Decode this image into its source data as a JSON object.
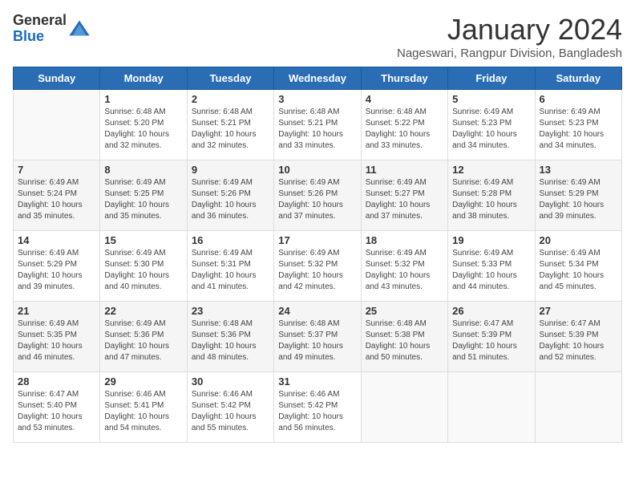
{
  "logo": {
    "general": "General",
    "blue": "Blue"
  },
  "title": "January 2024",
  "location": "Nageswari, Rangpur Division, Bangladesh",
  "days": [
    "Sunday",
    "Monday",
    "Tuesday",
    "Wednesday",
    "Thursday",
    "Friday",
    "Saturday"
  ],
  "weeks": [
    [
      {
        "num": "",
        "info": ""
      },
      {
        "num": "1",
        "info": "Sunrise: 6:48 AM\nSunset: 5:20 PM\nDaylight: 10 hours\nand 32 minutes."
      },
      {
        "num": "2",
        "info": "Sunrise: 6:48 AM\nSunset: 5:21 PM\nDaylight: 10 hours\nand 32 minutes."
      },
      {
        "num": "3",
        "info": "Sunrise: 6:48 AM\nSunset: 5:21 PM\nDaylight: 10 hours\nand 33 minutes."
      },
      {
        "num": "4",
        "info": "Sunrise: 6:48 AM\nSunset: 5:22 PM\nDaylight: 10 hours\nand 33 minutes."
      },
      {
        "num": "5",
        "info": "Sunrise: 6:49 AM\nSunset: 5:23 PM\nDaylight: 10 hours\nand 34 minutes."
      },
      {
        "num": "6",
        "info": "Sunrise: 6:49 AM\nSunset: 5:23 PM\nDaylight: 10 hours\nand 34 minutes."
      }
    ],
    [
      {
        "num": "7",
        "info": "Sunrise: 6:49 AM\nSunset: 5:24 PM\nDaylight: 10 hours\nand 35 minutes."
      },
      {
        "num": "8",
        "info": "Sunrise: 6:49 AM\nSunset: 5:25 PM\nDaylight: 10 hours\nand 35 minutes."
      },
      {
        "num": "9",
        "info": "Sunrise: 6:49 AM\nSunset: 5:26 PM\nDaylight: 10 hours\nand 36 minutes."
      },
      {
        "num": "10",
        "info": "Sunrise: 6:49 AM\nSunset: 5:26 PM\nDaylight: 10 hours\nand 37 minutes."
      },
      {
        "num": "11",
        "info": "Sunrise: 6:49 AM\nSunset: 5:27 PM\nDaylight: 10 hours\nand 37 minutes."
      },
      {
        "num": "12",
        "info": "Sunrise: 6:49 AM\nSunset: 5:28 PM\nDaylight: 10 hours\nand 38 minutes."
      },
      {
        "num": "13",
        "info": "Sunrise: 6:49 AM\nSunset: 5:29 PM\nDaylight: 10 hours\nand 39 minutes."
      }
    ],
    [
      {
        "num": "14",
        "info": "Sunrise: 6:49 AM\nSunset: 5:29 PM\nDaylight: 10 hours\nand 39 minutes."
      },
      {
        "num": "15",
        "info": "Sunrise: 6:49 AM\nSunset: 5:30 PM\nDaylight: 10 hours\nand 40 minutes."
      },
      {
        "num": "16",
        "info": "Sunrise: 6:49 AM\nSunset: 5:31 PM\nDaylight: 10 hours\nand 41 minutes."
      },
      {
        "num": "17",
        "info": "Sunrise: 6:49 AM\nSunset: 5:32 PM\nDaylight: 10 hours\nand 42 minutes."
      },
      {
        "num": "18",
        "info": "Sunrise: 6:49 AM\nSunset: 5:32 PM\nDaylight: 10 hours\nand 43 minutes."
      },
      {
        "num": "19",
        "info": "Sunrise: 6:49 AM\nSunset: 5:33 PM\nDaylight: 10 hours\nand 44 minutes."
      },
      {
        "num": "20",
        "info": "Sunrise: 6:49 AM\nSunset: 5:34 PM\nDaylight: 10 hours\nand 45 minutes."
      }
    ],
    [
      {
        "num": "21",
        "info": "Sunrise: 6:49 AM\nSunset: 5:35 PM\nDaylight: 10 hours\nand 46 minutes."
      },
      {
        "num": "22",
        "info": "Sunrise: 6:49 AM\nSunset: 5:36 PM\nDaylight: 10 hours\nand 47 minutes."
      },
      {
        "num": "23",
        "info": "Sunrise: 6:48 AM\nSunset: 5:36 PM\nDaylight: 10 hours\nand 48 minutes."
      },
      {
        "num": "24",
        "info": "Sunrise: 6:48 AM\nSunset: 5:37 PM\nDaylight: 10 hours\nand 49 minutes."
      },
      {
        "num": "25",
        "info": "Sunrise: 6:48 AM\nSunset: 5:38 PM\nDaylight: 10 hours\nand 50 minutes."
      },
      {
        "num": "26",
        "info": "Sunrise: 6:47 AM\nSunset: 5:39 PM\nDaylight: 10 hours\nand 51 minutes."
      },
      {
        "num": "27",
        "info": "Sunrise: 6:47 AM\nSunset: 5:39 PM\nDaylight: 10 hours\nand 52 minutes."
      }
    ],
    [
      {
        "num": "28",
        "info": "Sunrise: 6:47 AM\nSunset: 5:40 PM\nDaylight: 10 hours\nand 53 minutes."
      },
      {
        "num": "29",
        "info": "Sunrise: 6:46 AM\nSunset: 5:41 PM\nDaylight: 10 hours\nand 54 minutes."
      },
      {
        "num": "30",
        "info": "Sunrise: 6:46 AM\nSunset: 5:42 PM\nDaylight: 10 hours\nand 55 minutes."
      },
      {
        "num": "31",
        "info": "Sunrise: 6:46 AM\nSunset: 5:42 PM\nDaylight: 10 hours\nand 56 minutes."
      },
      {
        "num": "",
        "info": ""
      },
      {
        "num": "",
        "info": ""
      },
      {
        "num": "",
        "info": ""
      }
    ]
  ]
}
